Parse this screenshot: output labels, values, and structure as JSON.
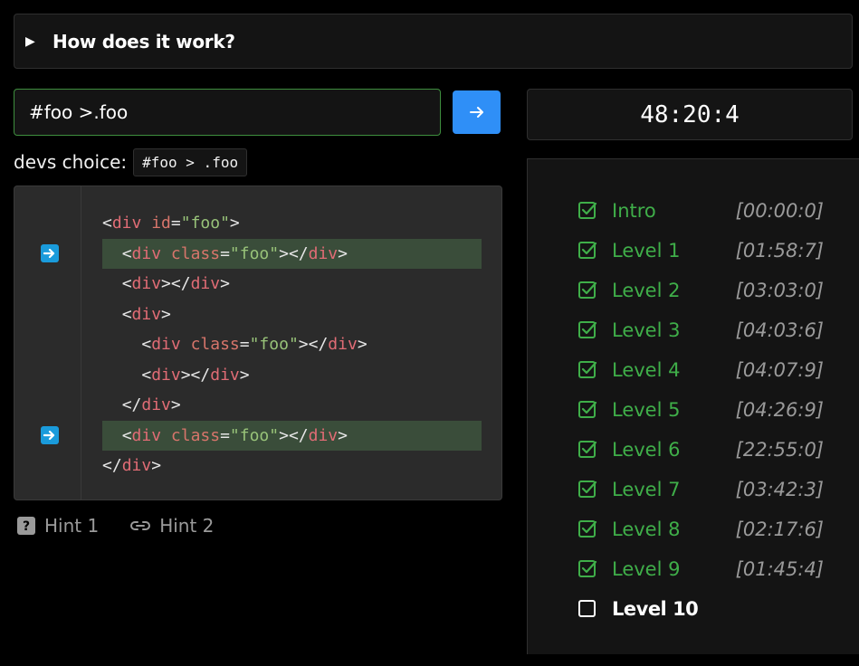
{
  "instructions": {
    "summary": "How does it work?",
    "toggle_icon": "triangle-right-icon"
  },
  "selector": {
    "value": "#foo >.foo",
    "submit_icon": "arrow-right-icon",
    "accent": "#2f8ff7",
    "valid_border": "#3e8e3e"
  },
  "devs_choice": {
    "label": "devs choice:",
    "value": "#foo > .foo"
  },
  "editor": {
    "lines": [
      {
        "indent": "",
        "parts": [
          [
            "punc",
            "<"
          ],
          [
            "tag",
            "div"
          ],
          [
            "punc",
            " "
          ],
          [
            "attr",
            "id"
          ],
          [
            "punc",
            "="
          ],
          [
            "val",
            "\"foo\""
          ],
          [
            "punc",
            ">"
          ]
        ],
        "highlight": false,
        "marked": false
      },
      {
        "indent": "  ",
        "parts": [
          [
            "punc",
            "<"
          ],
          [
            "tag",
            "div"
          ],
          [
            "punc",
            " "
          ],
          [
            "attr",
            "class"
          ],
          [
            "punc",
            "="
          ],
          [
            "val",
            "\"foo\""
          ],
          [
            "punc",
            "></"
          ],
          [
            "tag",
            "div"
          ],
          [
            "punc",
            ">"
          ]
        ],
        "highlight": true,
        "marked": true
      },
      {
        "indent": "  ",
        "parts": [
          [
            "punc",
            "<"
          ],
          [
            "tag",
            "div"
          ],
          [
            "punc",
            "></"
          ],
          [
            "tag",
            "div"
          ],
          [
            "punc",
            ">"
          ]
        ],
        "highlight": false,
        "marked": false
      },
      {
        "indent": "  ",
        "parts": [
          [
            "punc",
            "<"
          ],
          [
            "tag",
            "div"
          ],
          [
            "punc",
            ">"
          ]
        ],
        "highlight": false,
        "marked": false
      },
      {
        "indent": "    ",
        "parts": [
          [
            "punc",
            "<"
          ],
          [
            "tag",
            "div"
          ],
          [
            "punc",
            " "
          ],
          [
            "attr",
            "class"
          ],
          [
            "punc",
            "="
          ],
          [
            "val",
            "\"foo\""
          ],
          [
            "punc",
            "></"
          ],
          [
            "tag",
            "div"
          ],
          [
            "punc",
            ">"
          ]
        ],
        "highlight": false,
        "marked": false
      },
      {
        "indent": "    ",
        "parts": [
          [
            "punc",
            "<"
          ],
          [
            "tag",
            "div"
          ],
          [
            "punc",
            "></"
          ],
          [
            "tag",
            "div"
          ],
          [
            "punc",
            ">"
          ]
        ],
        "highlight": false,
        "marked": false
      },
      {
        "indent": "  ",
        "parts": [
          [
            "punc",
            "</"
          ],
          [
            "tag",
            "div"
          ],
          [
            "punc",
            ">"
          ]
        ],
        "highlight": false,
        "marked": false
      },
      {
        "indent": "  ",
        "parts": [
          [
            "punc",
            "<"
          ],
          [
            "tag",
            "div"
          ],
          [
            "punc",
            " "
          ],
          [
            "attr",
            "class"
          ],
          [
            "punc",
            "="
          ],
          [
            "val",
            "\"foo\""
          ],
          [
            "punc",
            "></"
          ],
          [
            "tag",
            "div"
          ],
          [
            "punc",
            ">"
          ]
        ],
        "highlight": true,
        "marked": true
      },
      {
        "indent": "",
        "parts": [
          [
            "punc",
            "</"
          ],
          [
            "tag",
            "div"
          ],
          [
            "punc",
            ">"
          ]
        ],
        "highlight": false,
        "marked": false
      }
    ]
  },
  "hints": [
    {
      "label": "Hint 1",
      "icon": "question-icon"
    },
    {
      "label": "Hint 2",
      "icon": "link-icon"
    }
  ],
  "timer": "48:20:4",
  "levels": [
    {
      "name": "Intro",
      "time": "[00:00:0]",
      "done": true
    },
    {
      "name": "Level 1",
      "time": "[01:58:7]",
      "done": true
    },
    {
      "name": "Level 2",
      "time": "[03:03:0]",
      "done": true
    },
    {
      "name": "Level 3",
      "time": "[04:03:6]",
      "done": true
    },
    {
      "name": "Level 4",
      "time": "[04:07:9]",
      "done": true
    },
    {
      "name": "Level 5",
      "time": "[04:26:9]",
      "done": true
    },
    {
      "name": "Level 6",
      "time": "[22:55:0]",
      "done": true
    },
    {
      "name": "Level 7",
      "time": "[03:42:3]",
      "done": true
    },
    {
      "name": "Level 8",
      "time": "[02:17:6]",
      "done": true
    },
    {
      "name": "Level 9",
      "time": "[01:45:4]",
      "done": true
    },
    {
      "name": "Level 10",
      "time": "",
      "done": false
    }
  ]
}
